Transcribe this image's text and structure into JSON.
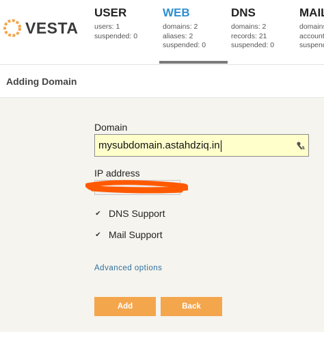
{
  "logo": {
    "text": "VESTA",
    "color": "#f4a64d"
  },
  "nav": {
    "user": {
      "title": "USER",
      "stats": [
        "users: 1",
        "suspended: 0"
      ]
    },
    "web": {
      "title": "WEB",
      "stats": [
        "domains: 2",
        "aliases: 2",
        "suspended: 0"
      ],
      "active": true
    },
    "dns": {
      "title": "DNS",
      "stats": [
        "domains: 2",
        "records: 21",
        "suspended: 0"
      ]
    },
    "mail": {
      "title": "MAIL",
      "stats": [
        "domains:",
        "accounts",
        "suspend"
      ]
    }
  },
  "page": {
    "title": "Adding Domain"
  },
  "form": {
    "domain_label": "Domain",
    "domain_value": "mysubdomain.astahdziq.in",
    "ip_label": "IP address",
    "ip_value": "",
    "dns_support_label": "DNS Support",
    "dns_support_checked": true,
    "mail_support_label": "Mail Support",
    "mail_support_checked": true,
    "advanced_label": "Advanced options",
    "add_label": "Add",
    "back_label": "Back"
  },
  "colors": {
    "accent": "#f4a64d",
    "active_nav": "#2f8fcf",
    "input_bg": "#ffffcc",
    "content_bg": "#f5f4ee",
    "redaction": "#ff5a00"
  }
}
